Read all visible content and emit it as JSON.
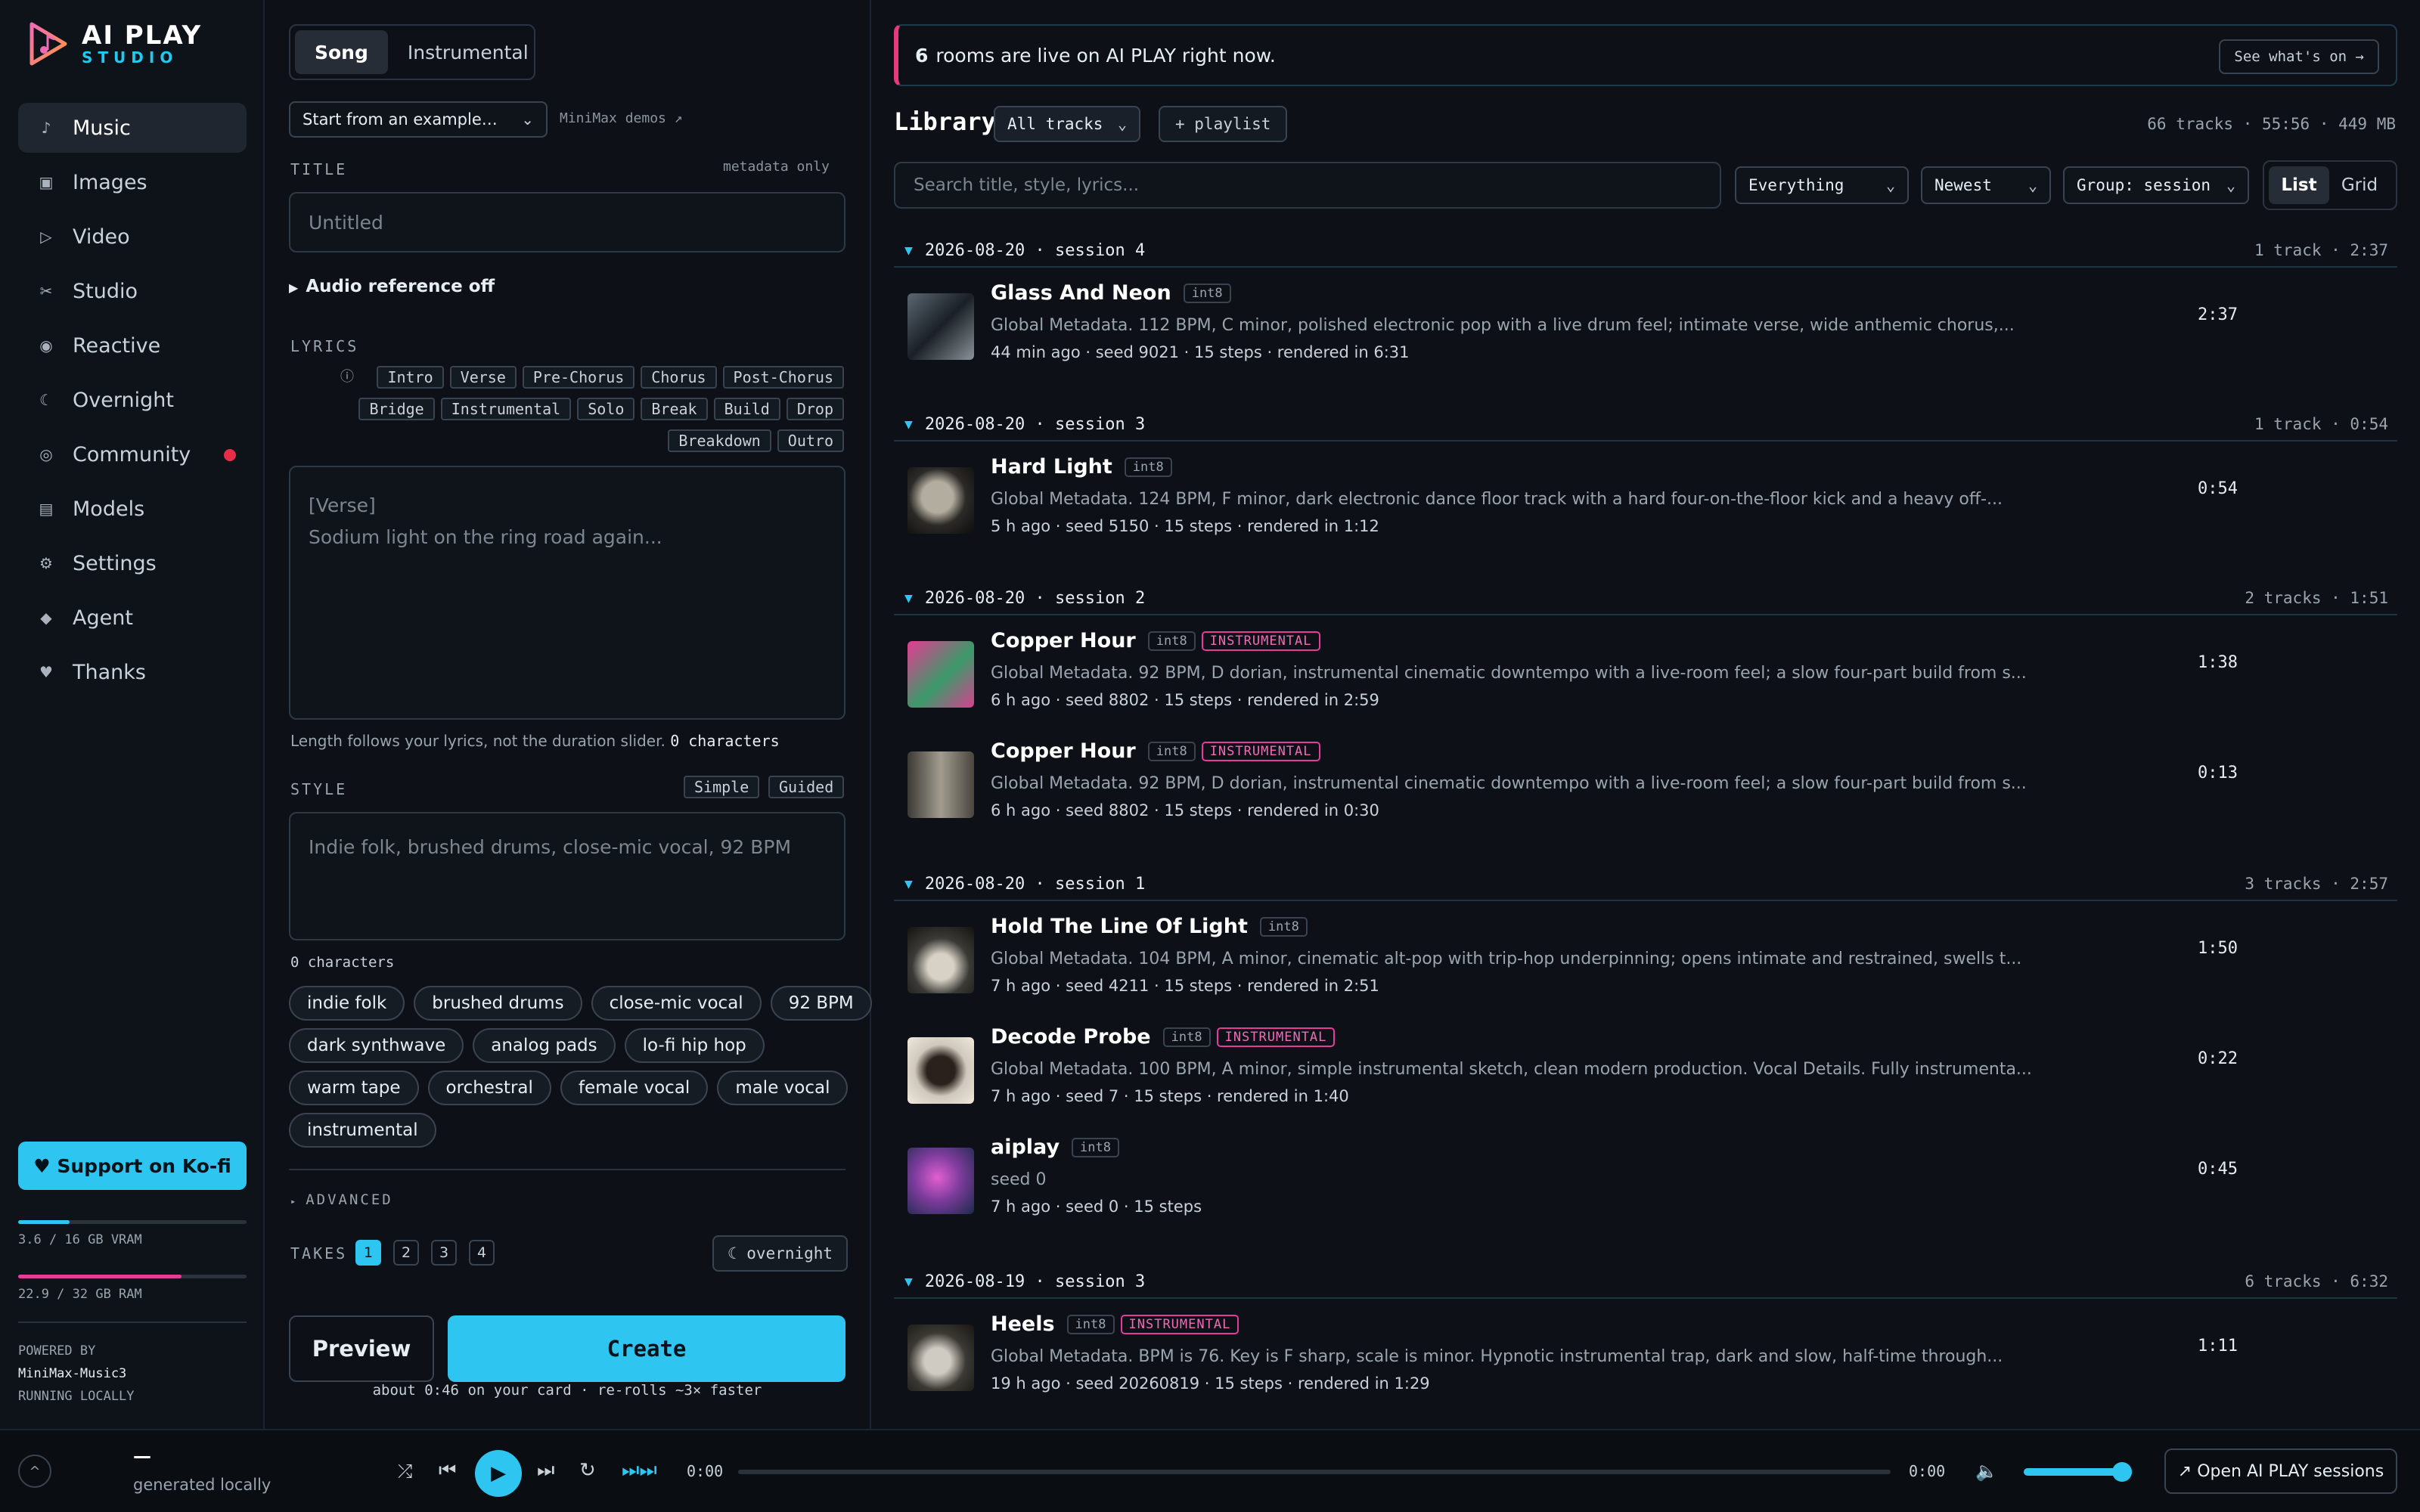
{
  "brand": {
    "title": "AI PLAY",
    "subtitle": "STUDIO"
  },
  "nav": [
    {
      "label": "Music",
      "icon": "♪"
    },
    {
      "label": "Images",
      "icon": "▣"
    },
    {
      "label": "Video",
      "icon": "▷"
    },
    {
      "label": "Studio",
      "icon": "✂"
    },
    {
      "label": "Reactive",
      "icon": "◉"
    },
    {
      "label": "Overnight",
      "icon": "☾"
    },
    {
      "label": "Community",
      "icon": "◎"
    },
    {
      "label": "Models",
      "icon": "▤"
    },
    {
      "label": "Settings",
      "icon": "⚙"
    },
    {
      "label": "Agent",
      "icon": "◆"
    },
    {
      "label": "Thanks",
      "icon": "♥"
    }
  ],
  "sidebar": {
    "kofi": "♥ Support on Ko-fi",
    "vram": "3.6 / 16 GB VRAM",
    "vram_fraction": 0.225,
    "ram": "22.9 / 32 GB RAM",
    "ram_fraction": 0.716,
    "powered_by": "POWERED BY",
    "model": "MiniMax-Music3",
    "running": "RUNNING LOCALLY"
  },
  "composer": {
    "mode_tabs": [
      "Song",
      "Instrumental"
    ],
    "example_select": "Start from an example…",
    "demos_link": "MiniMax demos ↗",
    "title_label": "TITLE",
    "title_note": "metadata only",
    "title_placeholder": "Untitled",
    "audio_ref": "Audio reference off",
    "lyrics_label": "LYRICS",
    "lyric_tags_row1": [
      "Intro",
      "Verse",
      "Pre-Chorus",
      "Chorus",
      "Post-Chorus"
    ],
    "lyric_tags_row2": [
      "Bridge",
      "Instrumental",
      "Solo",
      "Break",
      "Build",
      "Drop"
    ],
    "lyric_tags_row3": [
      "Breakdown",
      "Outro"
    ],
    "lyrics_placeholder_1": "[Verse]",
    "lyrics_placeholder_2": "Sodium light on the ring road again...",
    "lyrics_hint": "Length follows your lyrics, not the duration slider.",
    "lyrics_count": "0 characters",
    "style_label": "STYLE",
    "style_modes": [
      "Simple",
      "Guided"
    ],
    "style_placeholder": "Indie folk, brushed drums, close-mic vocal, 92 BPM",
    "style_count": "0 characters",
    "chips_row1": [
      "indie folk",
      "brushed drums",
      "close-mic vocal",
      "92 BPM"
    ],
    "chips_row2": [
      "dark synthwave",
      "analog pads",
      "lo-fi hip hop"
    ],
    "chips_row3": [
      "warm tape",
      "orchestral",
      "female vocal",
      "male vocal"
    ],
    "chips_row4": [
      "instrumental"
    ],
    "advanced": "ADVANCED",
    "takes_label": "TAKES",
    "takes": [
      "1",
      "2",
      "3",
      "4"
    ],
    "overnight": "☾ overnight",
    "preview": "Preview",
    "create": "Create",
    "create_hint": "about 0:46 on your card · re-rolls ~3× faster"
  },
  "banner": {
    "count": "6",
    "text": "rooms are live on AI PLAY right now.",
    "button": "See what's on →"
  },
  "library": {
    "title": "Library",
    "filter": "All tracks",
    "playlist": "+ playlist",
    "summary": "66 tracks · 55:56 · 449 MB",
    "search_placeholder": "Search title, style, lyrics...",
    "scope": "Everything",
    "sort": "Newest",
    "group": "Group: session",
    "views": [
      "List",
      "Grid"
    ]
  },
  "groups": [
    {
      "label": "2026-08-20 · session 4",
      "meta": "1 track · 2:37"
    },
    {
      "label": "2026-08-20 · session 3",
      "meta": "1 track · 0:54"
    },
    {
      "label": "2026-08-20 · session 2",
      "meta": "2 tracks · 1:51"
    },
    {
      "label": "2026-08-20 · session 1",
      "meta": "3 tracks · 2:57"
    },
    {
      "label": "2026-08-19 · session 3",
      "meta": "6 tracks · 6:32"
    }
  ],
  "tracks": [
    {
      "title": "Glass And Neon",
      "badge": "int8",
      "desc": "Global Metadata. 112 BPM, C minor, polished electronic pop with a live drum feel; intimate verse, wide anthemic chorus,...",
      "meta": "44 min ago · seed 9021 · 15 steps · rendered in 6:31",
      "duration": "2:37"
    },
    {
      "title": "Hard Light",
      "badge": "int8",
      "desc": "Global Metadata. 124 BPM, F minor, dark electronic dance floor track with a hard four-on-the-floor kick and a heavy off-...",
      "meta": "5 h ago · seed 5150 · 15 steps · rendered in 1:12",
      "duration": "0:54"
    },
    {
      "title": "Copper Hour",
      "badge": "int8",
      "inst": "INSTRUMENTAL",
      "desc": "Global Metadata. 92 BPM, D dorian, instrumental cinematic downtempo with a live-room feel; a slow four-part build from s...",
      "meta": "6 h ago · seed 8802 · 15 steps · rendered in 2:59",
      "duration": "1:38"
    },
    {
      "title": "Copper Hour",
      "badge": "int8",
      "inst": "INSTRUMENTAL",
      "desc": "Global Metadata. 92 BPM, D dorian, instrumental cinematic downtempo with a live-room feel; a slow four-part build from s...",
      "meta": "6 h ago · seed 8802 · 15 steps · rendered in 0:30",
      "duration": "0:13"
    },
    {
      "title": "Hold The Line Of Light",
      "badge": "int8",
      "desc": "Global Metadata. 104 BPM, A minor, cinematic alt-pop with trip-hop underpinning; opens intimate and restrained, swells t...",
      "meta": "7 h ago · seed 4211 · 15 steps · rendered in 2:51",
      "duration": "1:50"
    },
    {
      "title": "Decode Probe",
      "badge": "int8",
      "inst": "INSTRUMENTAL",
      "desc": "Global Metadata. 100 BPM, A minor, simple instrumental sketch, clean modern production. Vocal Details. Fully instrumenta...",
      "meta": "7 h ago · seed 7 · 15 steps · rendered in 1:40",
      "duration": "0:22"
    },
    {
      "title": "aiplay",
      "badge": "int8",
      "desc": "seed 0",
      "meta": "7 h ago · seed 0 · 15 steps",
      "duration": "0:45"
    },
    {
      "title": "Heels",
      "badge": "int8",
      "inst": "INSTRUMENTAL",
      "desc": "Global Metadata. BPM is 76. Key is F sharp, scale is minor. Hypnotic instrumental trap, dark and slow, half-time through...",
      "meta": "19 h ago · seed 20260819 · 15 steps · rendered in 1:29",
      "duration": "1:11"
    }
  ],
  "player": {
    "title": "—",
    "subtitle": "generated locally",
    "elapsed": "0:00",
    "total": "0:00",
    "volume_fraction": 0.9,
    "sessions": "↗ Open AI PLAY sessions"
  },
  "colors": {
    "accent": "#2ec6f0",
    "instrumental": "#e53b9a",
    "alert": "#e52d48"
  }
}
